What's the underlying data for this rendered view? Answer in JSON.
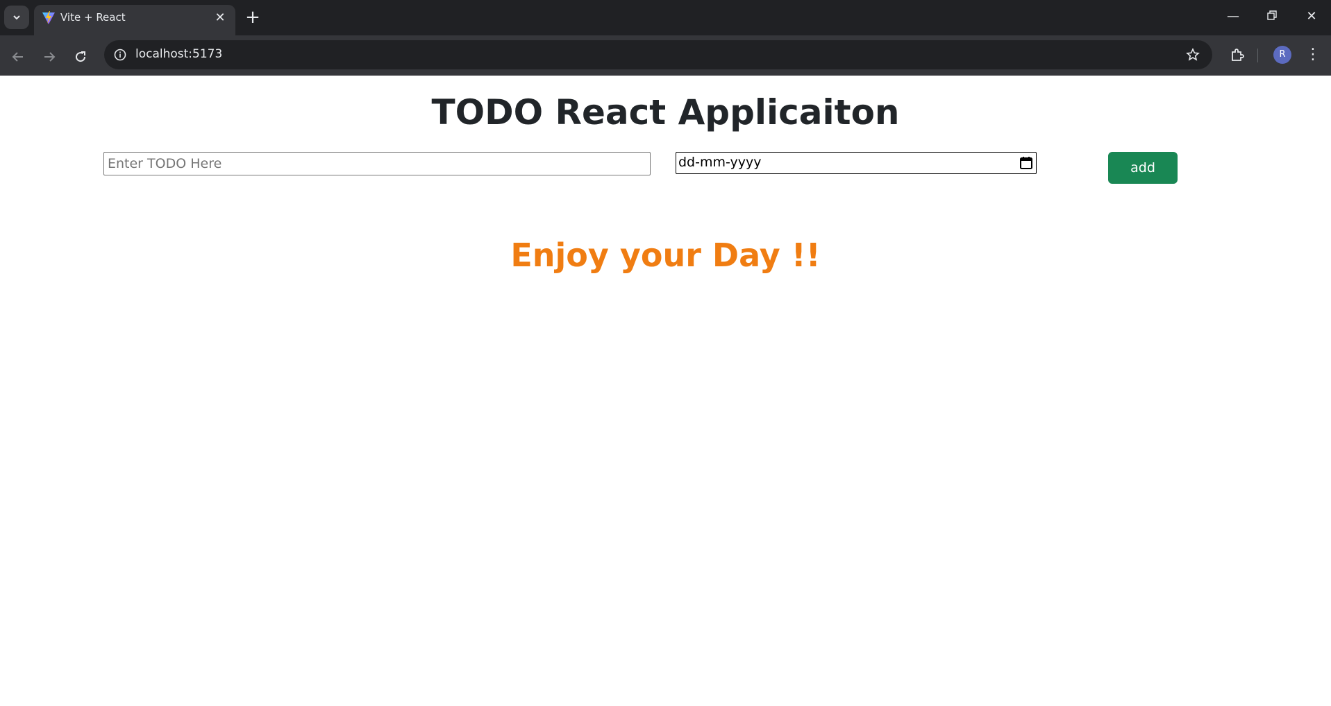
{
  "browser": {
    "tab_title": "Vite + React",
    "url": "localhost:5173",
    "profile_initial": "R"
  },
  "app": {
    "title": "TODO React Applicaiton",
    "todo_placeholder": "Enter TODO Here",
    "todo_value": "",
    "date_placeholder": "dd-mm-yyyy",
    "add_label": "add",
    "empty_message": "Enjoy your Day !!"
  },
  "colors": {
    "add_button": "#198754",
    "empty_message": "#f07d12",
    "title": "#212529"
  }
}
